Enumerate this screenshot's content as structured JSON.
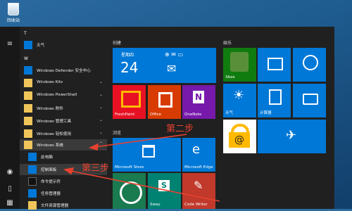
{
  "desktop": {
    "recycle_label": "回收站"
  },
  "start_menu": {
    "letters": [
      "T",
      "W"
    ],
    "apps": [
      {
        "label": "天气",
        "sub": false,
        "chevron": false,
        "icon": "weather-icon"
      },
      {
        "label": "Windows Defender 安全中心",
        "sub": false,
        "chevron": false,
        "icon": "shield-icon"
      },
      {
        "label": "Windows Kits",
        "sub": false,
        "chevron": true,
        "icon": "folder-icon"
      },
      {
        "label": "Windows PowerShell",
        "sub": false,
        "chevron": true,
        "icon": "folder-icon"
      },
      {
        "label": "Windows 附件",
        "sub": false,
        "chevron": true,
        "icon": "folder-icon"
      },
      {
        "label": "Windows 管理工具",
        "sub": false,
        "chevron": true,
        "icon": "folder-icon"
      },
      {
        "label": "Windows 轻松使用",
        "sub": false,
        "chevron": true,
        "icon": "folder-icon"
      },
      {
        "label": "Windows 系统",
        "sub": false,
        "chevron": true,
        "icon": "folder-icon"
      },
      {
        "label": "此电脑",
        "sub": true,
        "chevron": false,
        "icon": "computer-icon"
      },
      {
        "label": "控制面板",
        "sub": true,
        "chevron": false,
        "icon": "control-panel-icon"
      },
      {
        "label": "命令提示符",
        "sub": true,
        "chevron": false,
        "icon": "cmd-icon"
      },
      {
        "label": "任务管理器",
        "sub": true,
        "chevron": false,
        "icon": "task-manager-icon"
      },
      {
        "label": "文件资源管理器",
        "sub": true,
        "chevron": false,
        "icon": "explorer-icon"
      }
    ],
    "groups": {
      "create": "创建",
      "browse": "浏览",
      "play": "娱乐"
    },
    "tiles": {
      "calendar_day": "星期四",
      "calendar_date": "24",
      "freshpaint": "FreshPaint",
      "office": "Office",
      "onenote": "OneNote",
      "store": "Microsoft Store",
      "edge": "Microsoft Edge",
      "sway": "Sway",
      "codewriter": "Code Writer",
      "xbox": "Xbox",
      "weather": "天气",
      "calc": "计算器"
    }
  },
  "annotations": {
    "step2": "第二步",
    "step3": "第三步"
  },
  "colors": {
    "tile_blue": "#0078d7",
    "annotation_red": "#e8412f"
  }
}
